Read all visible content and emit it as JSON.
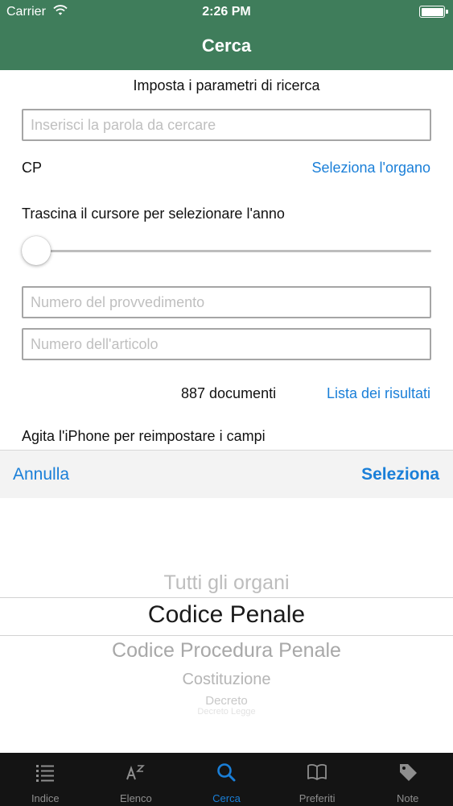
{
  "status_bar": {
    "carrier": "Carrier",
    "time": "2:26 PM"
  },
  "nav": {
    "title": "Cerca"
  },
  "form": {
    "heading": "Imposta i parametri di ricerca",
    "search_placeholder": "Inserisci la parola da cercare",
    "organ_code": "CP",
    "select_organ_link": "Seleziona l'organo",
    "year_label": "Trascina il cursore per selezionare l'anno",
    "year_slider_value": 0,
    "number_placeholder": "Numero del provvedimento",
    "article_placeholder": "Numero dell'articolo",
    "document_count": "887 documenti",
    "results_link": "Lista dei risultati",
    "shake_hint": "Agita l'iPhone per reimpostare i campi"
  },
  "picker": {
    "cancel_label": "Annulla",
    "select_label": "Seleziona",
    "options": [
      "Tutti gli organi",
      "Codice Penale",
      "Codice Procedura Penale",
      "Costituzione",
      "Decreto",
      "Decreto Legge"
    ],
    "selected": "Codice Penale"
  },
  "tab_bar": {
    "active": "Cerca",
    "tabs": [
      {
        "label": "Indice",
        "icon": "list-icon"
      },
      {
        "label": "Elenco",
        "icon": "alphabetical-sort-icon"
      },
      {
        "label": "Cerca",
        "icon": "search-icon"
      },
      {
        "label": "Preferiti",
        "icon": "book-icon"
      },
      {
        "label": "Note",
        "icon": "tag-icon"
      }
    ]
  },
  "colors": {
    "nav_bar": "#3f7d5b",
    "accent": "#1a7fd8",
    "tab_bar": "#141414"
  }
}
